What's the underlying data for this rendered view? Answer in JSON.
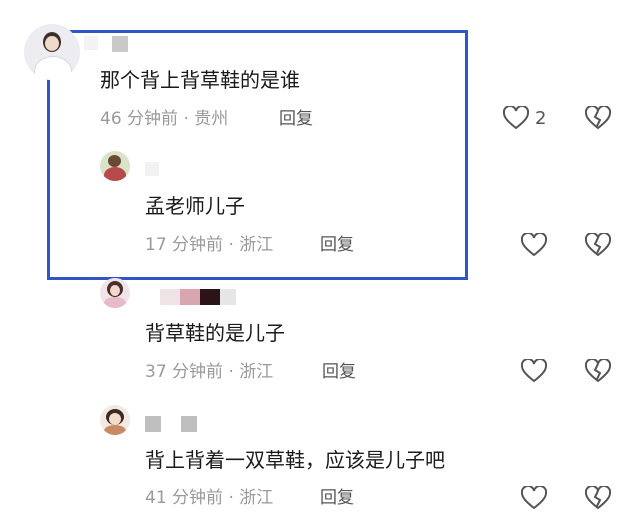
{
  "comments": [
    {
      "text": "那个背上背草鞋的是谁",
      "time": "46 分钟前 · 贵州",
      "reply_label": "回复",
      "like_count": "2",
      "icons": [
        "heart-outline-icon",
        "broken-heart-icon"
      ]
    },
    {
      "text": "孟老师儿子",
      "time": "17 分钟前 · 浙江",
      "reply_label": "回复",
      "icons": [
        "heart-outline-icon",
        "broken-heart-icon"
      ]
    },
    {
      "text": "背草鞋的是儿子",
      "time": "37 分钟前 · 浙江",
      "reply_label": "回复",
      "icons": [
        "heart-outline-icon",
        "broken-heart-icon"
      ]
    },
    {
      "text": "背上背着一双草鞋，应该是儿子吧",
      "time": "41 分钟前 · 浙江",
      "reply_label": "回复",
      "icons": [
        "heart-outline-icon",
        "broken-heart-icon"
      ]
    }
  ],
  "colors": {
    "highlight_border": "#2f56c8",
    "meta_text": "#9a9a9a",
    "icon_stroke": "#555555"
  }
}
